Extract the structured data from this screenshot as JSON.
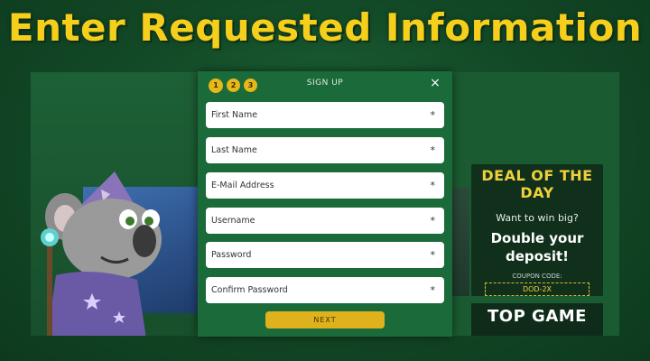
{
  "headline": "Enter Requested Information",
  "modal": {
    "title": "SIGN UP",
    "steps": [
      "1",
      "2",
      "3"
    ],
    "close_icon": "×",
    "fields": [
      {
        "placeholder": "First Name",
        "required_mark": "*"
      },
      {
        "placeholder": "Last Name",
        "required_mark": "*"
      },
      {
        "placeholder": "E-Mail Address",
        "required_mark": "*"
      },
      {
        "placeholder": "Username",
        "required_mark": "*"
      },
      {
        "placeholder": "Password",
        "required_mark": "*"
      },
      {
        "placeholder": "Confirm Password",
        "required_mark": "*"
      }
    ],
    "next_label": "NEXT"
  },
  "promo": {
    "title": "DEAL OF THE DAY",
    "question": "Want to win big?",
    "offer_line1": "Double your",
    "offer_line2": "deposit!",
    "coupon_label": "COUPON CODE:",
    "coupon_code": "DOD-2X"
  },
  "promo2": {
    "title": "TOP GAME"
  },
  "colors": {
    "headline": "#f5cf1b",
    "background": "#134a27",
    "modal": "#1a6a3a",
    "accent": "#dfb11c"
  },
  "icons": {
    "close": "close-icon",
    "step": "step-indicator",
    "mascot": "koala-wizard-illustration"
  }
}
